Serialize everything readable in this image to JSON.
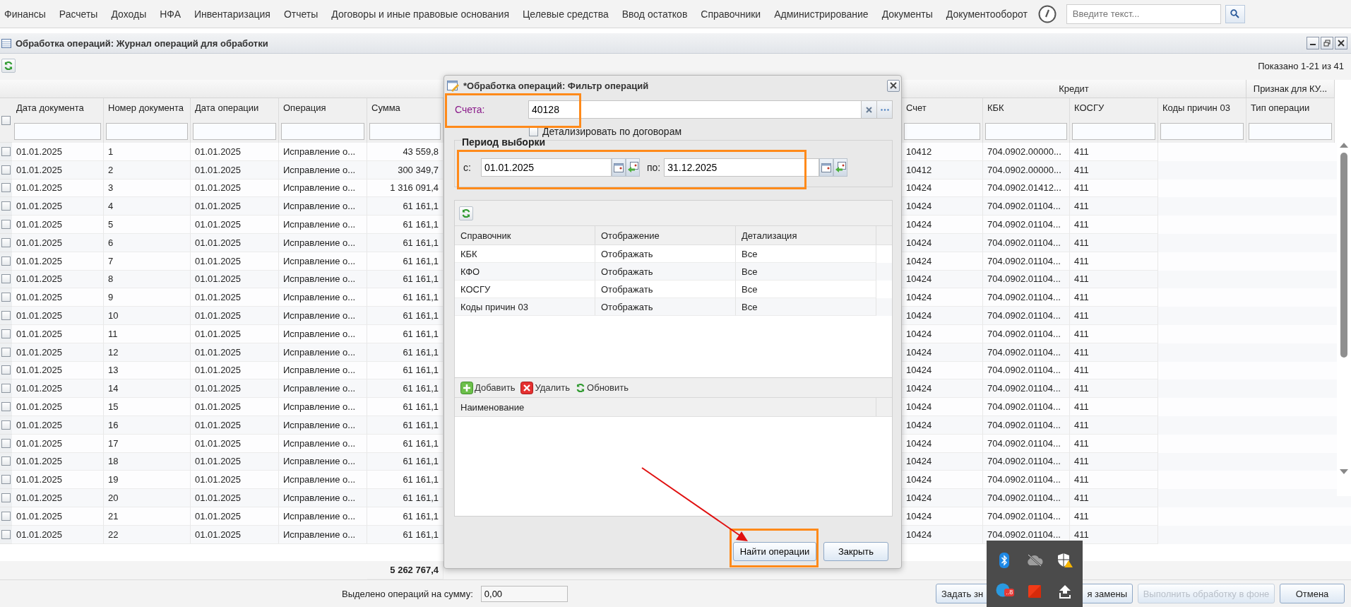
{
  "menu": {
    "items": [
      "Финансы",
      "Расчеты",
      "Доходы",
      "НФА",
      "Инвентаризация",
      "Отчеты",
      "Договоры и иные правовые основания",
      "Целевые средства",
      "Ввод остатков",
      "Справочники",
      "Администрирование",
      "Документы",
      "Документооборот"
    ],
    "search": {
      "placeholder": "Введите текст..."
    }
  },
  "window": {
    "title": "Обработка операций: Журнал операций для обработки",
    "shown": "Показано 1-21 из 41"
  },
  "table": {
    "column_groups": [
      {
        "label": "Кредит"
      },
      {
        "label": "Признак для КУ..."
      }
    ],
    "select_all": {
      "checked": false
    },
    "columns": [
      "Дата документа",
      "Номер документа",
      "Дата операции",
      "Операция",
      "Сумма",
      "Счет",
      "КБК",
      "КОСГУ",
      "Коды причин 03",
      "Тип операции"
    ],
    "rows": [
      {
        "checked": false,
        "cells": [
          "01.01.2025",
          "1",
          "01.01.2025",
          "Исправление о...",
          "43 559,8",
          "10412",
          "704.0902.00000...",
          "411"
        ]
      },
      {
        "checked": false,
        "cells": [
          "01.01.2025",
          "2",
          "01.01.2025",
          "Исправление о...",
          "300 349,7",
          "10412",
          "704.0902.00000...",
          "411"
        ]
      },
      {
        "checked": false,
        "cells": [
          "01.01.2025",
          "3",
          "01.01.2025",
          "Исправление о...",
          "1 316 091,4",
          "10424",
          "704.0902.01412...",
          "411"
        ]
      },
      {
        "checked": false,
        "cells": [
          "01.01.2025",
          "4",
          "01.01.2025",
          "Исправление о...",
          "61 161,1",
          "10424",
          "704.0902.01104...",
          "411"
        ]
      },
      {
        "checked": false,
        "cells": [
          "01.01.2025",
          "5",
          "01.01.2025",
          "Исправление о...",
          "61 161,1",
          "10424",
          "704.0902.01104...",
          "411"
        ]
      },
      {
        "checked": false,
        "cells": [
          "01.01.2025",
          "6",
          "01.01.2025",
          "Исправление о...",
          "61 161,1",
          "10424",
          "704.0902.01104...",
          "411"
        ]
      },
      {
        "checked": false,
        "cells": [
          "01.01.2025",
          "7",
          "01.01.2025",
          "Исправление о...",
          "61 161,1",
          "10424",
          "704.0902.01104...",
          "411"
        ]
      },
      {
        "checked": false,
        "cells": [
          "01.01.2025",
          "8",
          "01.01.2025",
          "Исправление о...",
          "61 161,1",
          "10424",
          "704.0902.01104...",
          "411"
        ]
      },
      {
        "checked": false,
        "cells": [
          "01.01.2025",
          "9",
          "01.01.2025",
          "Исправление о...",
          "61 161,1",
          "10424",
          "704.0902.01104...",
          "411"
        ]
      },
      {
        "checked": false,
        "cells": [
          "01.01.2025",
          "10",
          "01.01.2025",
          "Исправление о...",
          "61 161,1",
          "10424",
          "704.0902.01104...",
          "411"
        ]
      },
      {
        "checked": false,
        "cells": [
          "01.01.2025",
          "11",
          "01.01.2025",
          "Исправление о...",
          "61 161,1",
          "10424",
          "704.0902.01104...",
          "411"
        ]
      },
      {
        "checked": false,
        "cells": [
          "01.01.2025",
          "12",
          "01.01.2025",
          "Исправление о...",
          "61 161,1",
          "10424",
          "704.0902.01104...",
          "411"
        ]
      },
      {
        "checked": false,
        "cells": [
          "01.01.2025",
          "13",
          "01.01.2025",
          "Исправление о...",
          "61 161,1",
          "10424",
          "704.0902.01104...",
          "411"
        ]
      },
      {
        "checked": false,
        "cells": [
          "01.01.2025",
          "14",
          "01.01.2025",
          "Исправление о...",
          "61 161,1",
          "10424",
          "704.0902.01104...",
          "411"
        ]
      },
      {
        "checked": false,
        "cells": [
          "01.01.2025",
          "15",
          "01.01.2025",
          "Исправление о...",
          "61 161,1",
          "10424",
          "704.0902.01104...",
          "411"
        ]
      },
      {
        "checked": false,
        "cells": [
          "01.01.2025",
          "16",
          "01.01.2025",
          "Исправление о...",
          "61 161,1",
          "10424",
          "704.0902.01104...",
          "411"
        ]
      },
      {
        "checked": false,
        "cells": [
          "01.01.2025",
          "17",
          "01.01.2025",
          "Исправление о...",
          "61 161,1",
          "10424",
          "704.0902.01104...",
          "411"
        ]
      },
      {
        "checked": false,
        "cells": [
          "01.01.2025",
          "18",
          "01.01.2025",
          "Исправление о...",
          "61 161,1",
          "10424",
          "704.0902.01104...",
          "411"
        ]
      },
      {
        "checked": false,
        "cells": [
          "01.01.2025",
          "19",
          "01.01.2025",
          "Исправление о...",
          "61 161,1",
          "10424",
          "704.0902.01104...",
          "411"
        ]
      },
      {
        "checked": false,
        "cells": [
          "01.01.2025",
          "20",
          "01.01.2025",
          "Исправление о...",
          "61 161,1",
          "10424",
          "704.0902.01104...",
          "411"
        ]
      },
      {
        "checked": false,
        "cells": [
          "01.01.2025",
          "21",
          "01.01.2025",
          "Исправление о...",
          "61 161,1",
          "10424",
          "704.0902.01104...",
          "411"
        ]
      },
      {
        "checked": false,
        "cells": [
          "01.01.2025",
          "22",
          "01.01.2025",
          "Исправление о...",
          "61 161,1",
          "10424",
          "704.0902.01104...",
          "411"
        ]
      }
    ],
    "total": "5 262 767,4"
  },
  "bottom": {
    "selected_label": "Выделено операций на сумму:",
    "selected_value": "0,00",
    "buttons": [
      {
        "label": "Задать зн",
        "disabled": false
      },
      {
        "label": "я замены",
        "disabled": false
      },
      {
        "label": "Выполнить обработку в фоне",
        "disabled": true
      },
      {
        "label": "Отмена",
        "disabled": false
      }
    ]
  },
  "dialog": {
    "title": "*Обработка операций: Фильтр операций",
    "accounts": {
      "label": "Счета:",
      "value": "40128"
    },
    "detail_by_contracts": {
      "label": "Детализировать по договорам",
      "checked": false
    },
    "period": {
      "legend": "Период выборки",
      "from_label": "с:",
      "from": "01.01.2025",
      "to_label": "по:",
      "to": "31.12.2025"
    },
    "grid": {
      "columns": [
        "Справочник",
        "Отображение",
        "Детализация"
      ],
      "rows": [
        [
          "КБК",
          "Отображать",
          "Все"
        ],
        [
          "КФО",
          "Отображать",
          "Все"
        ],
        [
          "КОСГУ",
          "Отображать",
          "Все"
        ],
        [
          "Коды причин 03",
          "Отображать",
          "Все"
        ]
      ]
    },
    "toolbar": [
      {
        "kind": "add",
        "label": "Добавить"
      },
      {
        "kind": "delete",
        "label": "Удалить"
      },
      {
        "kind": "refresh",
        "label": "Обновить"
      }
    ],
    "list": {
      "columns": [
        "Наименование"
      ]
    },
    "buttons": [
      {
        "label": "Найти операции"
      },
      {
        "label": "Закрыть"
      }
    ]
  },
  "tray": {
    "badge": "..8"
  }
}
